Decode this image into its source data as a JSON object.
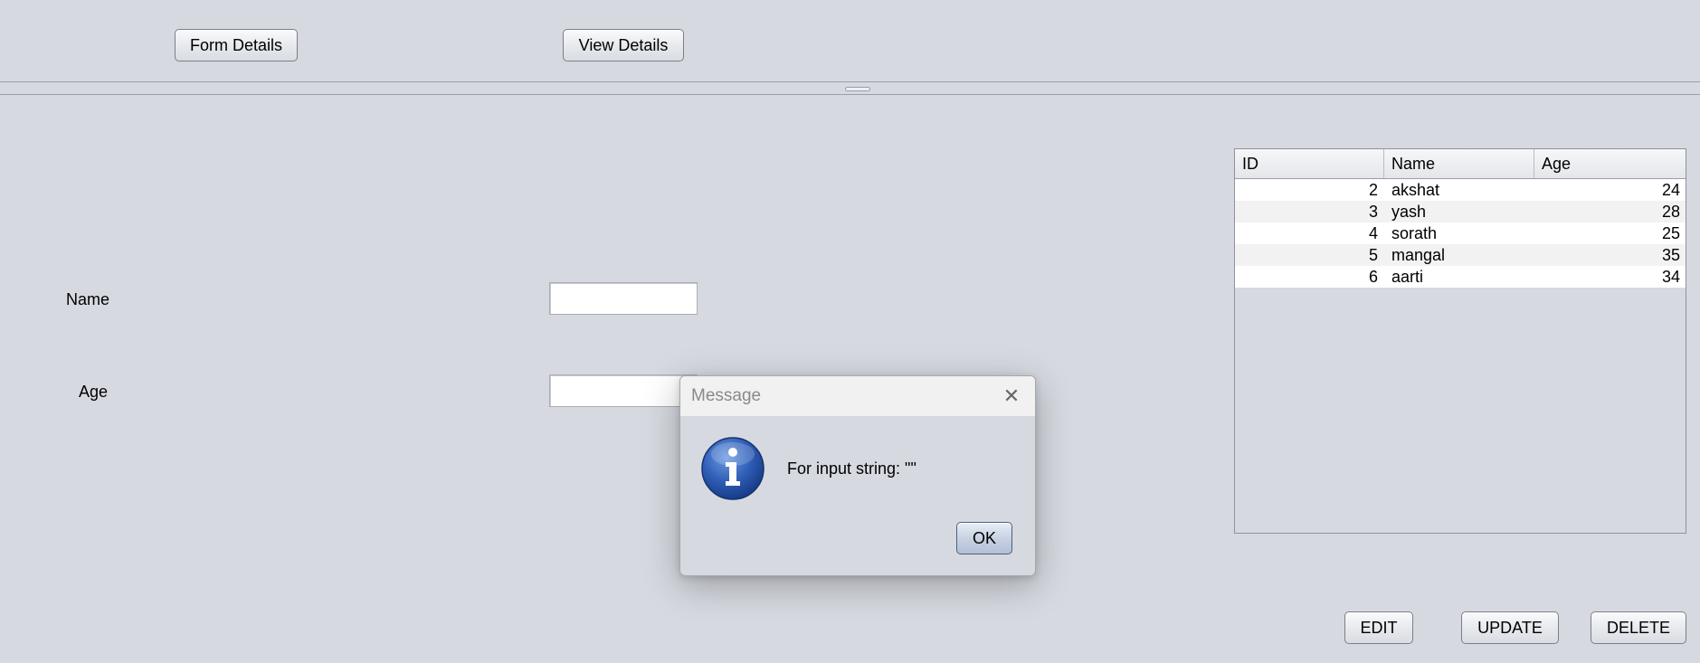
{
  "top_buttons": {
    "form_details": "Form Details",
    "view_details": "View Details"
  },
  "form": {
    "name_label": "Name",
    "age_label": "Age",
    "name_value": "",
    "age_value": ""
  },
  "table": {
    "headers": [
      "ID",
      "Name",
      "Age"
    ],
    "rows": [
      {
        "id": "2",
        "name": "akshat",
        "age": "24"
      },
      {
        "id": "3",
        "name": "yash",
        "age": "28"
      },
      {
        "id": "4",
        "name": "sorath",
        "age": "25"
      },
      {
        "id": "5",
        "name": "mangal",
        "age": "35"
      },
      {
        "id": "6",
        "name": "aarti",
        "age": "34"
      }
    ]
  },
  "actions": {
    "edit": "EDIT",
    "update": "UPDATE",
    "delete": "DELETE"
  },
  "dialog": {
    "title": "Message",
    "message": "For input string: \"\"",
    "ok": "OK",
    "icon": "info-icon",
    "close_glyph": "✕"
  },
  "colors": {
    "background": "#d6d9e0",
    "info_icon_blue": "#2f5fb7"
  }
}
